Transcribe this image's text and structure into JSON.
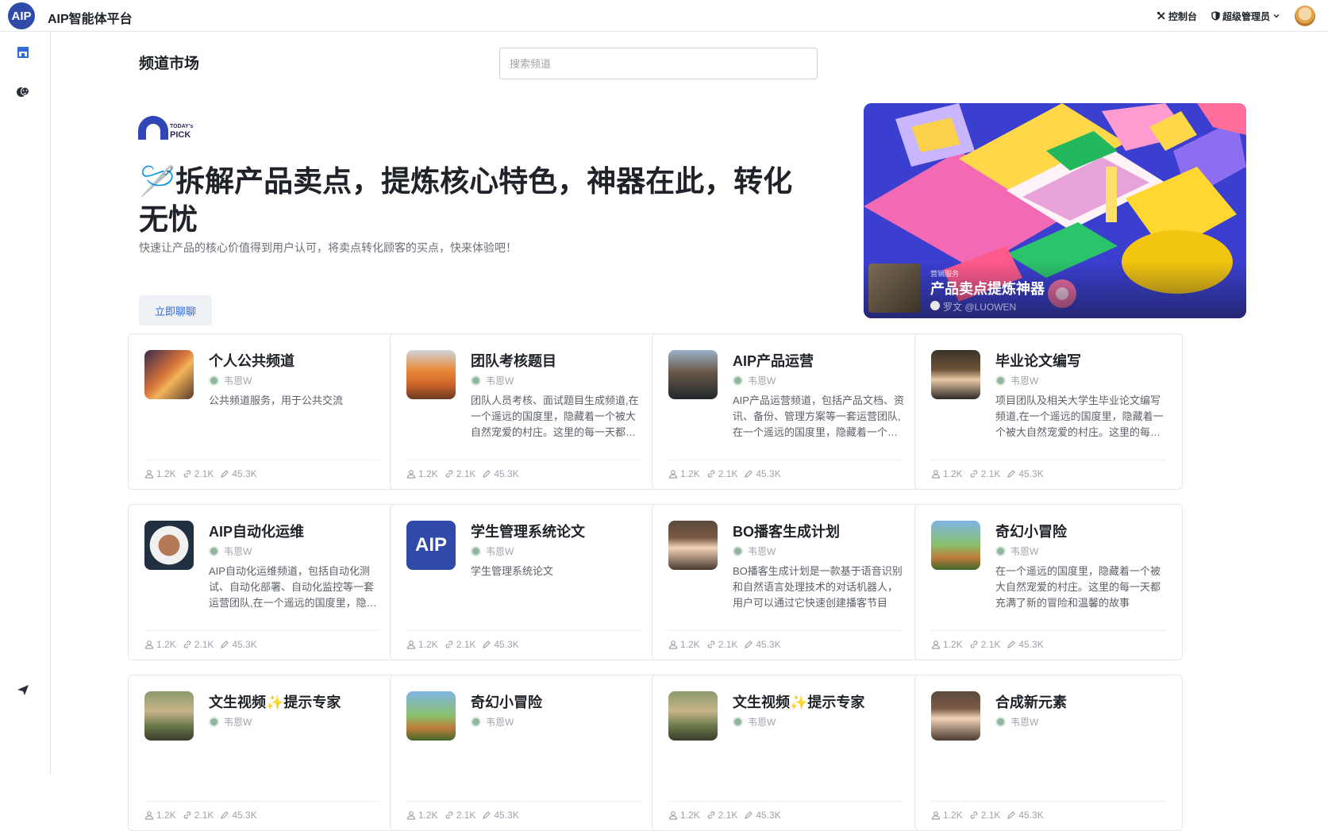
{
  "header": {
    "logo_text": "AIP",
    "app_title": "AIP智能体平台",
    "console_label": "控制台",
    "role_label": "超级管理员"
  },
  "page": {
    "title": "频道市场",
    "search_placeholder": "搜索频道"
  },
  "todays_pick": {
    "badge_line1": "TODAY's",
    "badge_line2": "PICK",
    "headline": "🪡拆解产品卖点，提炼核心特色，神器在此，转化无忧",
    "subtitle": "快速让产品的核心价值得到用户认可，将卖点转化顾客的买点，快来体验吧！",
    "cta_label": "立即聊聊",
    "banner": {
      "category": "营销服务",
      "name": "产品卖点提炼神器",
      "author": "罗文 @LUOWEN"
    }
  },
  "cards": [
    {
      "title": "个人公共频道",
      "author": "韦恩W",
      "desc": "公共频道服务，用于公共交流",
      "users": "1.2K",
      "links": "2.1K",
      "edits": "45.3K",
      "avatar": "cat-city"
    },
    {
      "title": "团队考核题目",
      "author": "韦恩W",
      "desc": "团队人员考核、面试题目生成频道,在一个遥远的国度里，隐藏着一个被大自然宠爱的村庄。这里的每一天都充满了新的冒险和温馨的故事",
      "users": "1.2K",
      "links": "2.1K",
      "edits": "45.3K",
      "avatar": "explorer"
    },
    {
      "title": "AIP产品运营",
      "author": "韦恩W",
      "desc": "AIP产品运营频道，包括产品文档、资讯、备份、管理方案等一套运营团队,在一个遥远的国度里，隐藏着一个被大自然宠爱的村庄",
      "users": "1.2K",
      "links": "2.1K",
      "edits": "45.3K",
      "avatar": "pilot"
    },
    {
      "title": "毕业论文编写",
      "author": "韦恩W",
      "desc": "项目团队及相关大学生毕业论文编写频道,在一个遥远的国度里，隐藏着一个被大自然宠爱的村庄。这里的每一天都充满了新的冒险",
      "users": "1.2K",
      "links": "2.1K",
      "edits": "45.3K",
      "avatar": "student"
    },
    {
      "title": "AIP自动化运维",
      "author": "韦恩W",
      "desc": "AIP自动化运维频道，包括自动化测试、自动化部署、自动化监控等一套运营团队,在一个遥远的国度里，隐藏着一个被大自然宠爱的村庄",
      "users": "1.2K",
      "links": "2.1K",
      "edits": "45.3K",
      "avatar": "astronaut"
    },
    {
      "title": "学生管理系统论文",
      "author": "韦恩W",
      "desc": "学生管理系统论文",
      "users": "1.2K",
      "links": "2.1K",
      "edits": "45.3K",
      "avatar": "aip-logo",
      "avatar_text": "AIP"
    },
    {
      "title": "BO播客生成计划",
      "author": "韦恩W",
      "desc": "BO播客生成计划是一款基于语音识别和自然语言处理技术的对话机器人，用户可以通过它快速创建播客节目",
      "users": "1.2K",
      "links": "2.1K",
      "edits": "45.3K",
      "avatar": "anime-girl"
    },
    {
      "title": "奇幻小冒险",
      "author": "韦恩W",
      "desc": "在一个遥远的国度里，隐藏着一个被大自然宠爱的村庄。这里的每一天都充满了新的冒险和温馨的故事",
      "users": "1.2K",
      "links": "2.1K",
      "edits": "45.3K",
      "avatar": "adventurer"
    },
    {
      "title": "文生视频✨提示专家",
      "author": "韦恩W",
      "desc": "",
      "users": "1.2K",
      "links": "2.1K",
      "edits": "45.3K",
      "avatar": "city-girl"
    },
    {
      "title": "奇幻小冒险",
      "author": "韦恩W",
      "desc": "",
      "users": "1.2K",
      "links": "2.1K",
      "edits": "45.3K",
      "avatar": "adventurer"
    },
    {
      "title": "文生视频✨提示专家",
      "author": "韦恩W",
      "desc": "",
      "users": "1.2K",
      "links": "2.1K",
      "edits": "45.3K",
      "avatar": "city-girl"
    },
    {
      "title": "合成新元素",
      "author": "韦恩W",
      "desc": "",
      "users": "1.2K",
      "links": "2.1K",
      "edits": "45.3K",
      "avatar": "anime-girl"
    }
  ],
  "colors": {
    "brand": "#2f4aa8",
    "accent_link": "#2f6bdb",
    "border": "#e5e6eb"
  }
}
